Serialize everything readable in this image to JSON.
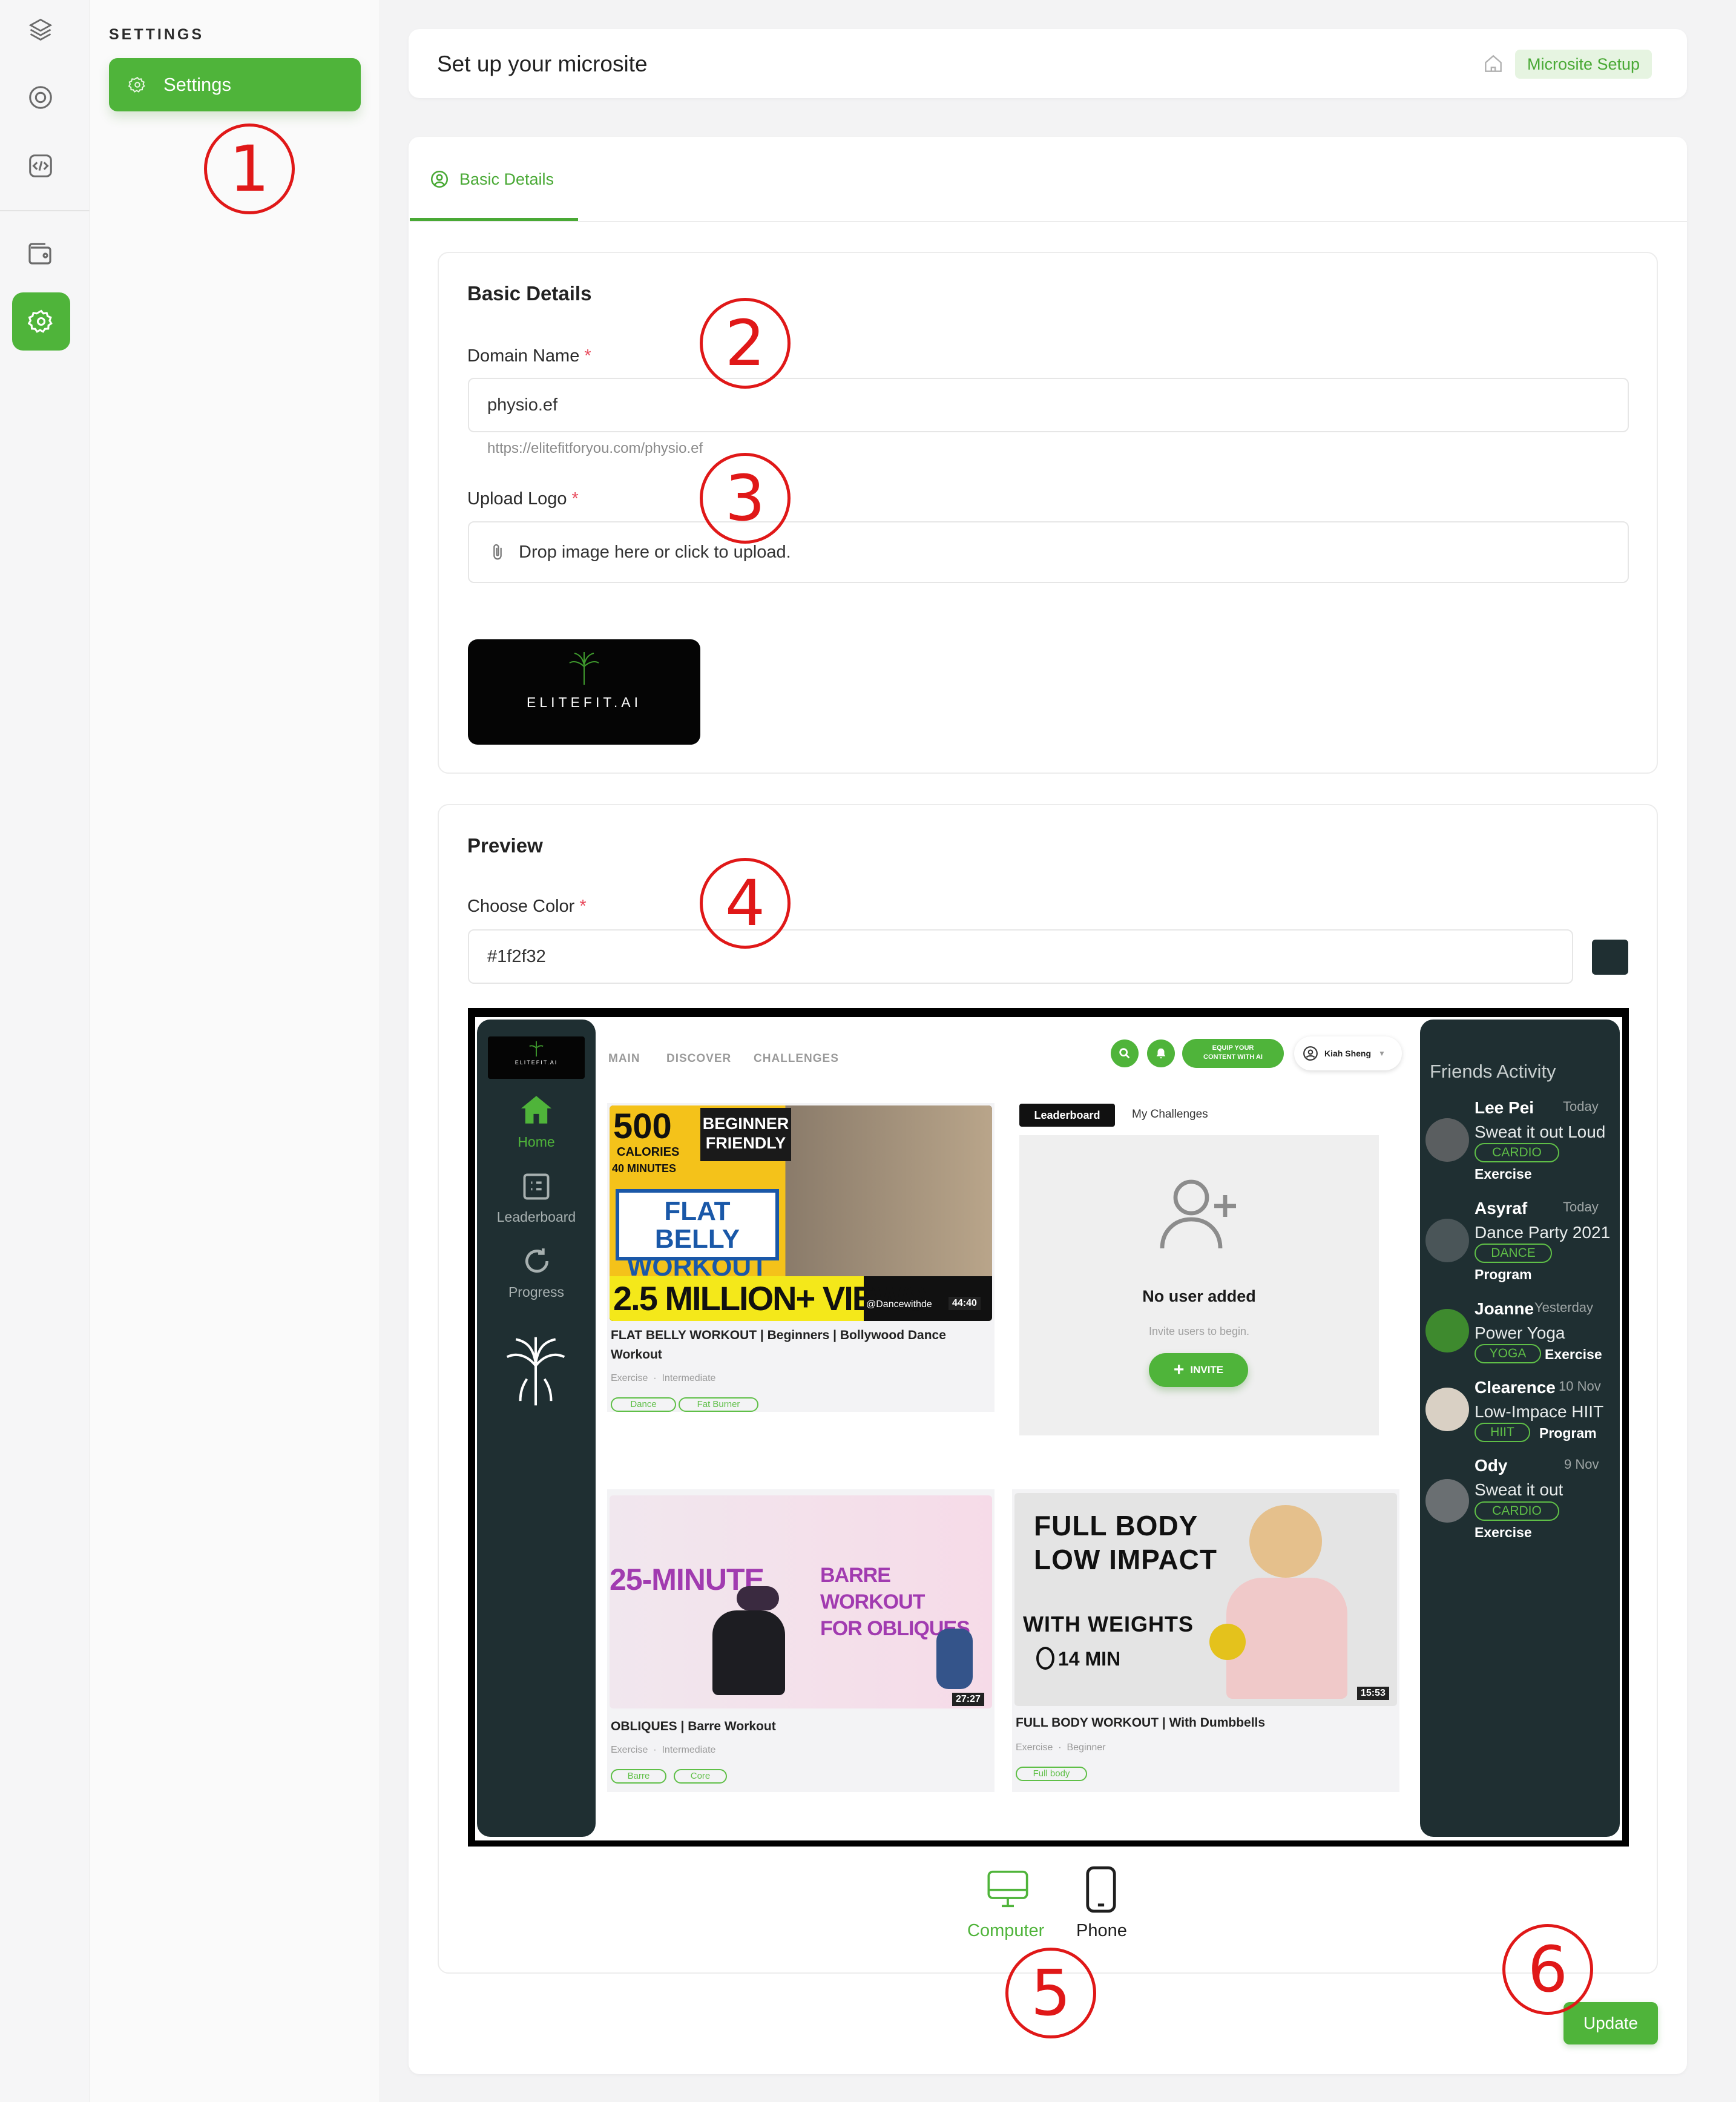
{
  "sidebar": {
    "icons": [
      "layers-icon",
      "lifebuoy-icon",
      "code-icon",
      "wallet-icon",
      "settings-icon"
    ],
    "active_icon": "settings-icon"
  },
  "subnav": {
    "title": "SETTINGS",
    "item_label": "Settings"
  },
  "header": {
    "title": "Set up your microsite",
    "breadcrumb": "Microsite Setup"
  },
  "tabs": [
    {
      "label": "Basic Details",
      "icon": "user-circle-icon",
      "active": true
    }
  ],
  "basic_details": {
    "heading": "Basic Details",
    "domain": {
      "label": "Domain Name",
      "required_mark": "*",
      "value": "physio.ef",
      "hint": "https://elitefitforyou.com/physio.ef"
    },
    "logo": {
      "label": "Upload Logo",
      "required_mark": "*",
      "placeholder": "Drop image here or click to upload.",
      "logo_text": "ELITEFIT.AI"
    }
  },
  "preview": {
    "heading": "Preview",
    "color": {
      "label": "Choose Color",
      "required_mark": "*",
      "value": "#1f2f32"
    },
    "screen": {
      "logo_text": "ELITEFIT.AI",
      "side_nav": [
        {
          "label": "Home",
          "icon": "home-icon",
          "active": true
        },
        {
          "label": "Leaderboard",
          "icon": "leaderboard-icon",
          "active": false
        },
        {
          "label": "Progress",
          "icon": "refresh-icon",
          "active": false
        }
      ],
      "top_nav": [
        "MAIN",
        "DISCOVER",
        "CHALLENGES"
      ],
      "cta_line1": "EQUIP YOUR",
      "cta_line2": "CONTENT WITH AI",
      "user_name": "Kiah Sheng",
      "videos": [
        {
          "thumb": {
            "kcal": "500",
            "kcal_unit": "CALORIES",
            "minutes": "40 MINUTES",
            "badge1": "BEGINNER",
            "badge2": "FRIENDLY",
            "title1": "FLAT BELLY",
            "title2": "WORKOUT",
            "views": "2.5 MILLION+ VIEWS",
            "handle": "@Dancewithde",
            "duration": "44:40"
          },
          "title1": "FLAT BELLY WORKOUT | Beginners | Bollywood Dance",
          "title2": "Workout",
          "category": "Exercise",
          "level": "Intermediate",
          "tags": [
            "Dance",
            "Fat Burner"
          ]
        },
        {
          "thumb": {
            "big": "25-MINUTE",
            "line1": "BARRE WORKOUT",
            "line2": "FOR OBLIQUES",
            "duration": "27:27"
          },
          "title": "OBLIQUES | Barre Workout",
          "category": "Exercise",
          "level": "Intermediate",
          "tags": [
            "Barre",
            "Core"
          ]
        },
        {
          "thumb": {
            "line1": "FULL BODY",
            "line2": "LOW IMPACT",
            "line3": "WITH WEIGHTS",
            "minutes": "14 MIN",
            "duration": "15:53"
          },
          "title": "FULL BODY WORKOUT | With Dumbbells",
          "category": "Exercise",
          "level": "Beginner",
          "tags": [
            "Full body"
          ]
        }
      ],
      "leaderboard": {
        "tab_active": "Leaderboard",
        "tab_other": "My Challenges",
        "empty_title": "No user added",
        "empty_sub": "Invite users to begin.",
        "invite": "INVITE"
      },
      "friends": {
        "title": "Friends Activity",
        "items": [
          {
            "name": "Lee Pei",
            "when": "Today",
            "activity": "Sweat it out Loud",
            "tag": "CARDIO",
            "type": "Exercise"
          },
          {
            "name": "Asyraf",
            "when": "Today",
            "activity": "Dance Party 2021",
            "tag": "DANCE",
            "type": "Program"
          },
          {
            "name": "Joanne",
            "when": "Yesterday",
            "activity": "Power Yoga",
            "tag": "YOGA",
            "type": "Exercise"
          },
          {
            "name": "Clearence",
            "when": "10 Nov",
            "activity": "Low-Impace HIIT",
            "tag": "HIIT",
            "type": "Program"
          },
          {
            "name": "Ody",
            "when": "9 Nov",
            "activity": "Sweat it out",
            "tag": "CARDIO",
            "type": "Exercise"
          }
        ]
      }
    },
    "devices": [
      {
        "label": "Computer",
        "icon": "monitor-icon",
        "active": true
      },
      {
        "label": "Phone",
        "icon": "phone-icon",
        "active": false
      }
    ]
  },
  "update_label": "Update",
  "markers": [
    "1",
    "2",
    "3",
    "4",
    "5",
    "6"
  ],
  "colors": {
    "accent": "#4fb43a",
    "preview_bg": "#1f2f32",
    "marker": "#e01818"
  }
}
